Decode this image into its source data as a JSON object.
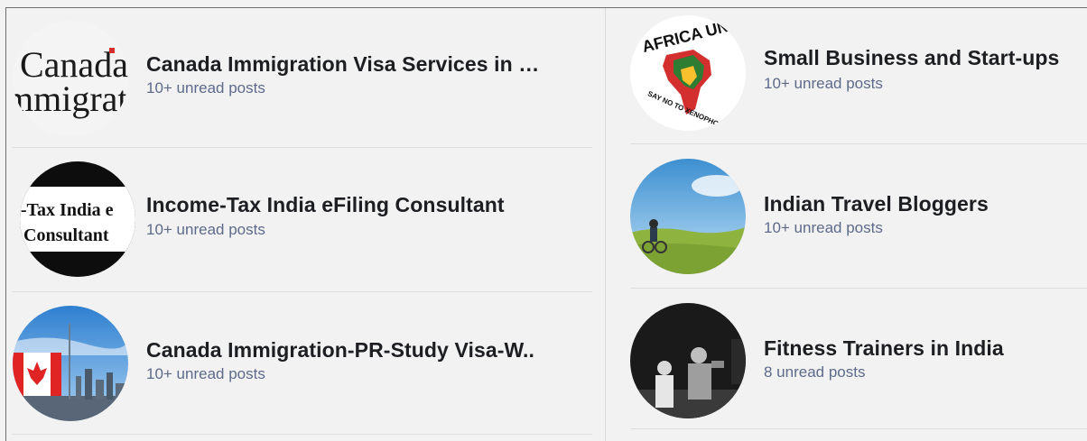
{
  "groups": [
    {
      "title": "Canada Immigration Visa Services in …",
      "status": "10+ unread posts",
      "avatar_text": [
        "Canada",
        "mmigrati"
      ],
      "avatar": "canada-wordmark-icon"
    },
    {
      "title": "Income-Tax India eFiling Consultant",
      "status": "10+ unread posts",
      "avatar_text": [
        "e-Tax India e",
        "Consultant"
      ],
      "avatar": "tax-consultant-icon"
    },
    {
      "title": "Canada Immigration-PR-Study Visa-W..",
      "status": "10+ unread posts",
      "avatar": "canada-flag-skyline-icon"
    },
    {
      "title": "Small Business and Start-ups",
      "status": "10+ unread posts",
      "avatar_text": [
        "AFRICA UNITE",
        "SAY NO TO XENOPHOBIA"
      ],
      "avatar": "africa-unite-icon"
    },
    {
      "title": "Indian Travel Bloggers",
      "status": "10+ unread posts",
      "avatar": "travel-landscape-icon"
    },
    {
      "title": "Fitness Trainers in India",
      "status": "8 unread posts",
      "avatar": "boxing-photo-icon"
    }
  ],
  "colors": {
    "title": "#1c1e21",
    "status": "#5d6a8a",
    "background": "#f2f2f2",
    "divider": "#dedede"
  }
}
